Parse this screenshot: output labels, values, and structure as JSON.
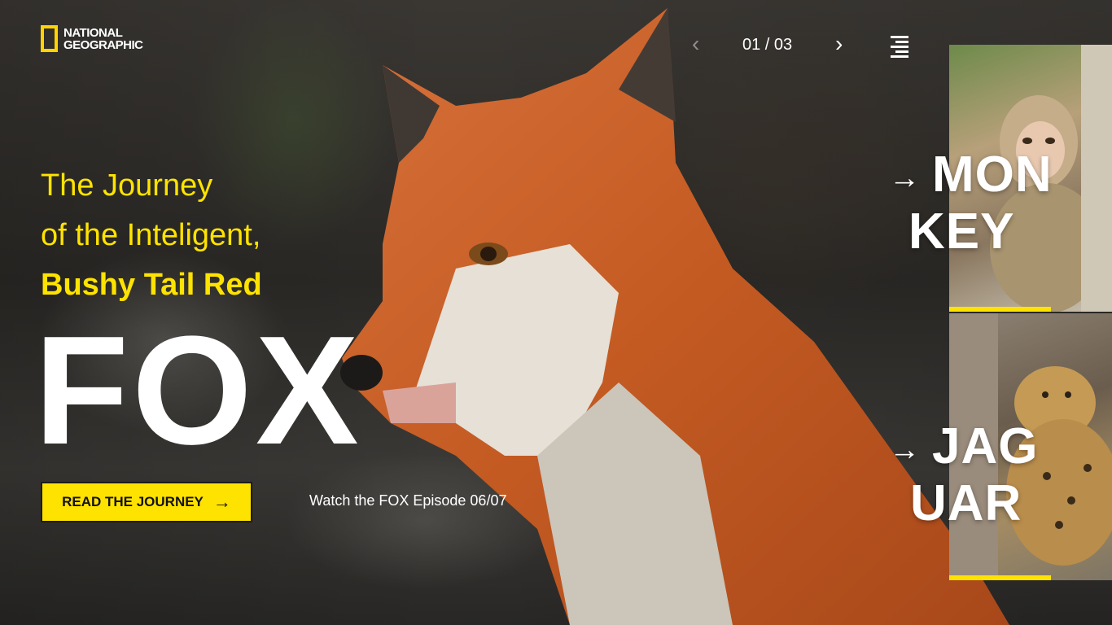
{
  "brand": {
    "line1": "NATIONAL",
    "line2": "GEOGRAPHIC",
    "accent": "#ffd400"
  },
  "pager": {
    "prev_icon": "chevron-left-icon",
    "next_icon": "chevron-right-icon",
    "counter": "01 / 03",
    "menu_icon": "menu-icon"
  },
  "hero": {
    "line1": "The Journey",
    "line2": "of the Inteligent,",
    "line3": "Bushy Tail Red",
    "title": "FOX",
    "cta_label": "READ THE JOURNEY",
    "cta_icon": "arrow-right-icon",
    "watch_label": "Watch the FOX Episode 06/07"
  },
  "cards": [
    {
      "line1": "MON",
      "line2": "KEY",
      "arrow_icon": "arrow-right-icon"
    },
    {
      "line1": "JAG",
      "line2": "UAR",
      "arrow_icon": "arrow-right-icon"
    }
  ],
  "colors": {
    "yellow": "#ffe300",
    "white": "#ffffff"
  }
}
